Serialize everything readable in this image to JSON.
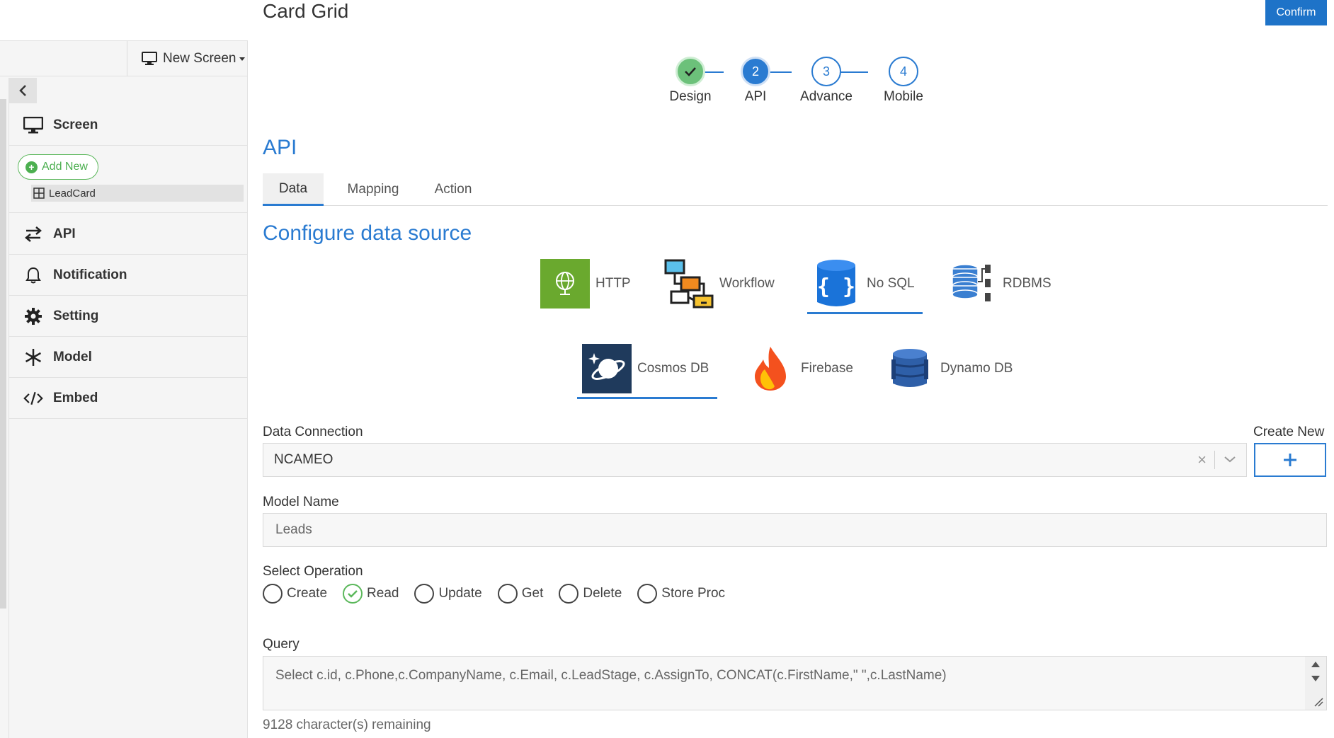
{
  "title": "Card Grid",
  "confirm_label": "Confirm",
  "new_screen_label": "New Screen",
  "sidebar": {
    "screen_label": "Screen",
    "add_new_label": "Add New",
    "items": [
      {
        "label": "LeadCard"
      }
    ],
    "menu": [
      {
        "label": "API",
        "icon": "arrows-exchange-icon"
      },
      {
        "label": "Notification",
        "icon": "bell-icon"
      },
      {
        "label": "Setting",
        "icon": "gear-icon"
      },
      {
        "label": "Model",
        "icon": "snowflake-icon"
      },
      {
        "label": "Embed",
        "icon": "code-icon"
      }
    ]
  },
  "stepper": {
    "steps": [
      {
        "number": "",
        "label": "Design",
        "state": "done"
      },
      {
        "number": "2",
        "label": "API",
        "state": "active"
      },
      {
        "number": "3",
        "label": "Advance",
        "state": "todo"
      },
      {
        "number": "4",
        "label": "Mobile",
        "state": "todo"
      }
    ]
  },
  "section_title": "API",
  "tabs": [
    {
      "label": "Data",
      "active": true
    },
    {
      "label": "Mapping",
      "active": false
    },
    {
      "label": "Action",
      "active": false
    }
  ],
  "config_title": "Configure data source",
  "data_sources": [
    {
      "label": "HTTP",
      "icon": "globe-icon"
    },
    {
      "label": "Workflow",
      "icon": "workflow-icon"
    },
    {
      "label": "No SQL",
      "icon": "nosql-icon",
      "selected": true
    },
    {
      "label": "RDBMS",
      "icon": "database-icon"
    },
    {
      "label": "Cosmos DB",
      "icon": "cosmos-icon",
      "selected": true
    },
    {
      "label": "Firebase",
      "icon": "firebase-icon"
    },
    {
      "label": "Dynamo DB",
      "icon": "dynamodb-icon"
    }
  ],
  "data_connection": {
    "label": "Data Connection",
    "value": "NCAMEO",
    "create_new_label": "Create New"
  },
  "model_name": {
    "label": "Model Name",
    "value": "Leads"
  },
  "operation": {
    "label": "Select Operation",
    "options": [
      "Create",
      "Read",
      "Update",
      "Get",
      "Delete",
      "Store Proc"
    ],
    "selected": "Read"
  },
  "query": {
    "label": "Query",
    "value": "Select c.id, c.Phone,c.CompanyName, c.Email, c.LeadStage, c.AssignTo, CONCAT(c.FirstName,\" \",c.LastName)",
    "remaining": "9128 character(s) remaining"
  },
  "colors": {
    "accent": "#2a7bd1",
    "success": "#5cb85c",
    "confirm": "#1e73c8"
  }
}
